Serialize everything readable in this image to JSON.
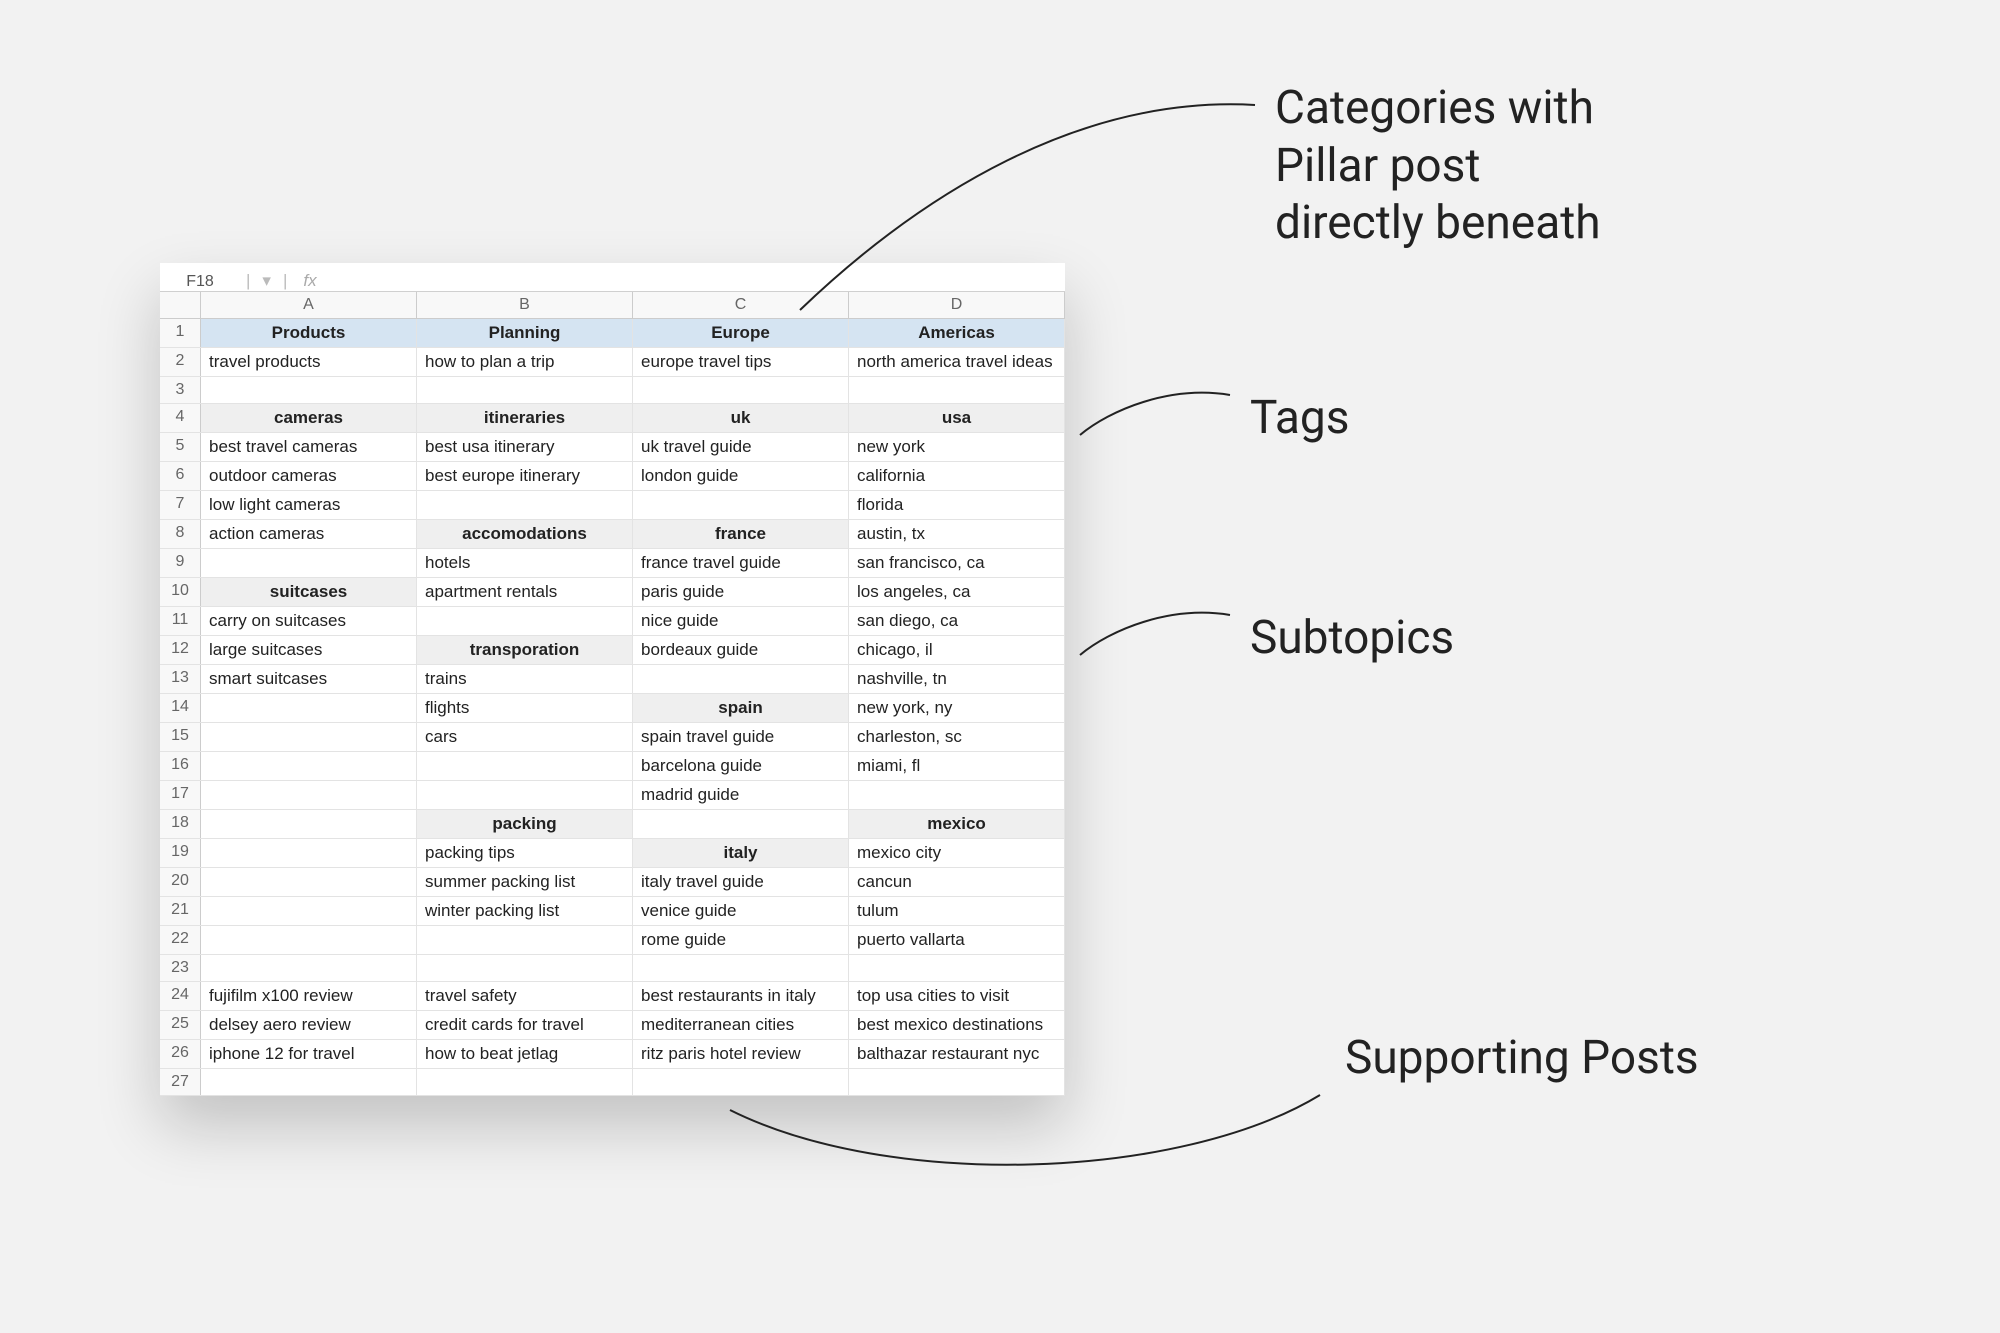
{
  "formula_bar": {
    "cell_ref": "F18",
    "fx": "fx"
  },
  "col_headers": [
    "A",
    "B",
    "C",
    "D"
  ],
  "rows": [
    {
      "n": 1,
      "cells": [
        {
          "t": "Products",
          "c": "h1"
        },
        {
          "t": "Planning",
          "c": "h1"
        },
        {
          "t": "Europe",
          "c": "h1"
        },
        {
          "t": "Americas",
          "c": "h1"
        }
      ]
    },
    {
      "n": 2,
      "cells": [
        {
          "t": "travel products"
        },
        {
          "t": "how to plan a trip"
        },
        {
          "t": "europe travel tips"
        },
        {
          "t": "north america travel ideas"
        }
      ]
    },
    {
      "n": 3,
      "cells": [
        {
          "t": ""
        },
        {
          "t": ""
        },
        {
          "t": ""
        },
        {
          "t": ""
        }
      ]
    },
    {
      "n": 4,
      "cells": [
        {
          "t": "cameras",
          "c": "h2"
        },
        {
          "t": "itineraries",
          "c": "h2"
        },
        {
          "t": "uk",
          "c": "h2"
        },
        {
          "t": "usa",
          "c": "h2"
        }
      ]
    },
    {
      "n": 5,
      "cells": [
        {
          "t": "best travel cameras"
        },
        {
          "t": "best usa itinerary"
        },
        {
          "t": "uk travel guide"
        },
        {
          "t": "new york"
        }
      ]
    },
    {
      "n": 6,
      "cells": [
        {
          "t": "outdoor cameras"
        },
        {
          "t": "best europe itinerary"
        },
        {
          "t": "london guide"
        },
        {
          "t": "california"
        }
      ]
    },
    {
      "n": 7,
      "cells": [
        {
          "t": "low light cameras"
        },
        {
          "t": ""
        },
        {
          "t": ""
        },
        {
          "t": "florida"
        }
      ]
    },
    {
      "n": 8,
      "cells": [
        {
          "t": "action cameras"
        },
        {
          "t": "accomodations",
          "c": "h2"
        },
        {
          "t": "france",
          "c": "h2"
        },
        {
          "t": "austin, tx"
        }
      ]
    },
    {
      "n": 9,
      "cells": [
        {
          "t": ""
        },
        {
          "t": "hotels"
        },
        {
          "t": "france travel guide"
        },
        {
          "t": "san francisco, ca"
        }
      ]
    },
    {
      "n": 10,
      "cells": [
        {
          "t": "suitcases",
          "c": "h2"
        },
        {
          "t": "apartment rentals"
        },
        {
          "t": "paris guide"
        },
        {
          "t": "los angeles, ca"
        }
      ]
    },
    {
      "n": 11,
      "cells": [
        {
          "t": "carry on suitcases"
        },
        {
          "t": ""
        },
        {
          "t": "nice guide"
        },
        {
          "t": "san diego, ca"
        }
      ]
    },
    {
      "n": 12,
      "cells": [
        {
          "t": "large suitcases"
        },
        {
          "t": "transporation",
          "c": "h2"
        },
        {
          "t": "bordeaux guide"
        },
        {
          "t": "chicago, il"
        }
      ]
    },
    {
      "n": 13,
      "cells": [
        {
          "t": "smart suitcases"
        },
        {
          "t": "trains"
        },
        {
          "t": ""
        },
        {
          "t": "nashville, tn"
        }
      ]
    },
    {
      "n": 14,
      "cells": [
        {
          "t": ""
        },
        {
          "t": "flights"
        },
        {
          "t": "spain",
          "c": "h2"
        },
        {
          "t": "new york, ny"
        }
      ]
    },
    {
      "n": 15,
      "cells": [
        {
          "t": ""
        },
        {
          "t": "cars"
        },
        {
          "t": "spain travel guide"
        },
        {
          "t": "charleston, sc"
        }
      ]
    },
    {
      "n": 16,
      "cells": [
        {
          "t": ""
        },
        {
          "t": ""
        },
        {
          "t": "barcelona guide"
        },
        {
          "t": "miami, fl"
        }
      ]
    },
    {
      "n": 17,
      "cells": [
        {
          "t": ""
        },
        {
          "t": ""
        },
        {
          "t": "madrid guide"
        },
        {
          "t": ""
        }
      ]
    },
    {
      "n": 18,
      "cells": [
        {
          "t": ""
        },
        {
          "t": "packing",
          "c": "h2"
        },
        {
          "t": ""
        },
        {
          "t": "mexico",
          "c": "h2"
        }
      ]
    },
    {
      "n": 19,
      "cells": [
        {
          "t": ""
        },
        {
          "t": "packing tips"
        },
        {
          "t": "italy",
          "c": "h2"
        },
        {
          "t": "mexico city"
        }
      ]
    },
    {
      "n": 20,
      "cells": [
        {
          "t": ""
        },
        {
          "t": "summer packing list"
        },
        {
          "t": "italy travel guide"
        },
        {
          "t": "cancun"
        }
      ]
    },
    {
      "n": 21,
      "cells": [
        {
          "t": ""
        },
        {
          "t": "winter packing list"
        },
        {
          "t": "venice guide"
        },
        {
          "t": "tulum"
        }
      ]
    },
    {
      "n": 22,
      "cells": [
        {
          "t": ""
        },
        {
          "t": ""
        },
        {
          "t": "rome guide"
        },
        {
          "t": "puerto vallarta"
        }
      ]
    },
    {
      "n": 23,
      "cells": [
        {
          "t": ""
        },
        {
          "t": ""
        },
        {
          "t": ""
        },
        {
          "t": ""
        }
      ]
    },
    {
      "n": 24,
      "cells": [
        {
          "t": "fujifilm x100 review"
        },
        {
          "t": "travel safety"
        },
        {
          "t": "best restaurants in italy"
        },
        {
          "t": "top usa cities to visit"
        }
      ]
    },
    {
      "n": 25,
      "cells": [
        {
          "t": "delsey aero review"
        },
        {
          "t": "credit cards for travel"
        },
        {
          "t": "mediterranean cities"
        },
        {
          "t": "best mexico destinations"
        }
      ]
    },
    {
      "n": 26,
      "cells": [
        {
          "t": "iphone 12 for travel"
        },
        {
          "t": "how to beat jetlag"
        },
        {
          "t": "ritz paris hotel review"
        },
        {
          "t": "balthazar restaurant nyc"
        }
      ]
    },
    {
      "n": 27,
      "cells": [
        {
          "t": ""
        },
        {
          "t": ""
        },
        {
          "t": ""
        },
        {
          "t": ""
        }
      ]
    }
  ],
  "annotations": {
    "categories": "Categories with\nPillar post\ndirectly beneath",
    "tags": "Tags",
    "subtopics": "Subtopics",
    "supporting": "Supporting Posts"
  }
}
